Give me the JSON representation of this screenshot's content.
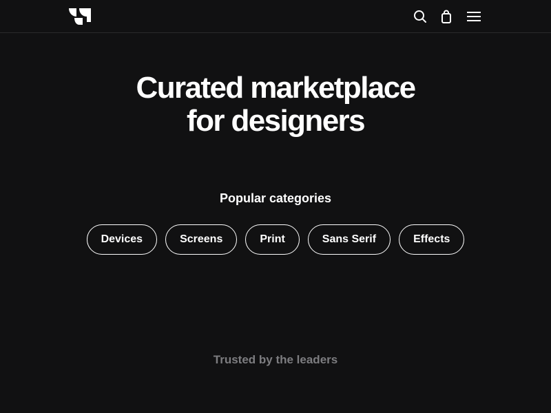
{
  "header": {
    "logo_icon": "brand-logo",
    "icons": {
      "search": "search-icon",
      "cart": "shopping-bag-icon",
      "menu": "hamburger-menu-icon"
    }
  },
  "hero": {
    "title_line1": "Curated marketplace",
    "title_line2": "for designers"
  },
  "categories": {
    "title": "Popular categories",
    "items": [
      "Devices",
      "Screens",
      "Print",
      "Sans Serif",
      "Effects"
    ]
  },
  "trusted": {
    "label": "Trusted by the leaders"
  },
  "colors": {
    "background": "#111112",
    "text": "#ffffff",
    "muted": "#7d7d80",
    "divider": "#2a2a2c"
  }
}
